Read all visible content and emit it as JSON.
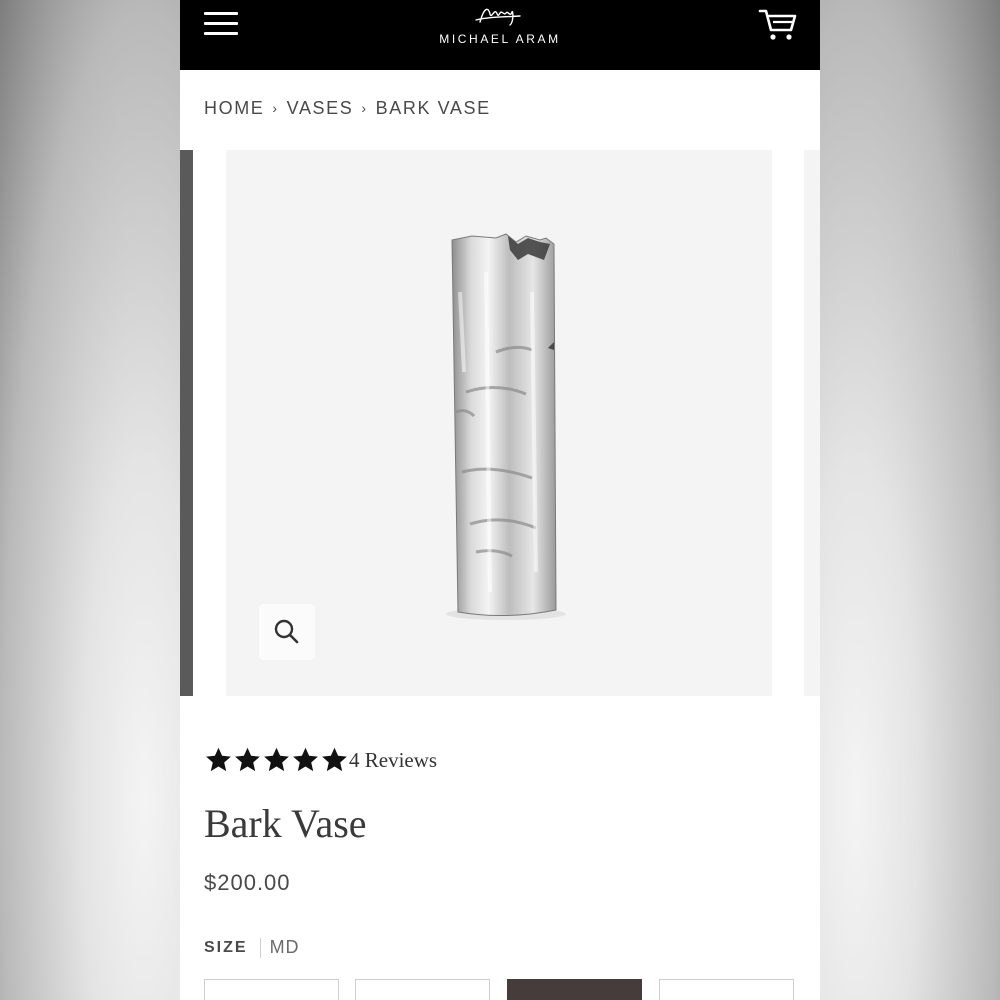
{
  "header": {
    "menu_icon": "hamburger-menu-icon",
    "brand_name": "MICHAEL ARAM",
    "cart_icon": "shopping-cart-icon",
    "background": "#000000"
  },
  "breadcrumb": {
    "items": [
      "HOME",
      "VASES",
      "BARK VASE"
    ],
    "separator": "›"
  },
  "gallery": {
    "zoom_icon": "magnifier-icon"
  },
  "product": {
    "rating_stars": 5,
    "reviews_label": "4 Reviews",
    "title": "Bark Vase",
    "price": "$200.00",
    "size_label": "SIZE",
    "size_value": "MD",
    "size_options_visible": 4,
    "selected_option_index": 2,
    "selected_color": "#473c3c"
  }
}
